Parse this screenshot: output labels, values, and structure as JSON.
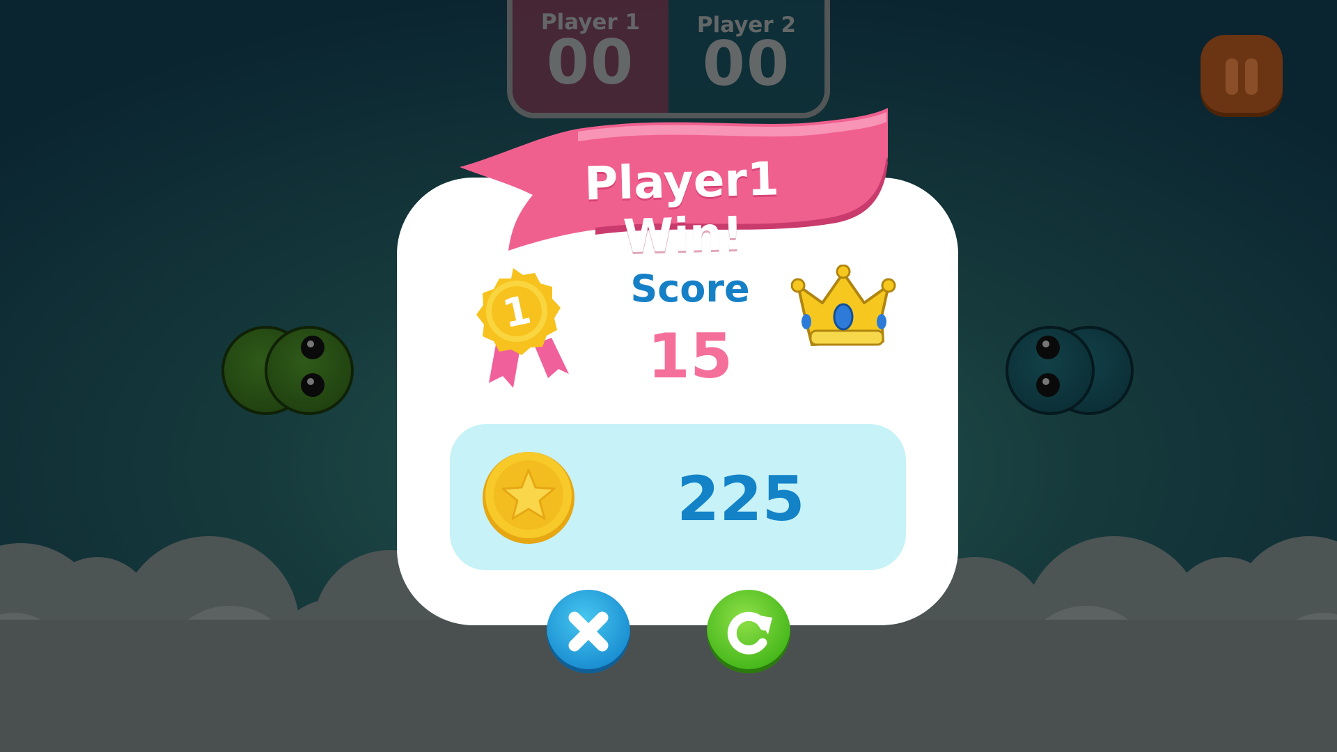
{
  "scoreboard": {
    "player1": {
      "name": "Player 1",
      "score": "00"
    },
    "player2": {
      "name": "Player 2",
      "score": "00"
    }
  },
  "result": {
    "title": "Player1 Win!",
    "score_label": "Score",
    "score_value": "15",
    "coins": "225",
    "medal_number": "1"
  },
  "icons": {
    "pause": "pause-icon",
    "medal": "medal-icon",
    "crown": "crown-icon",
    "coin": "coin-icon",
    "close": "close-icon",
    "retry": "retry-icon"
  },
  "colors": {
    "banner": "#f0608f",
    "score_label": "#1680c7",
    "score_value": "#f4709b",
    "coin_panel": "#c6f2f8",
    "close_button": "#1b8fd2",
    "retry_button": "#47b81c"
  }
}
